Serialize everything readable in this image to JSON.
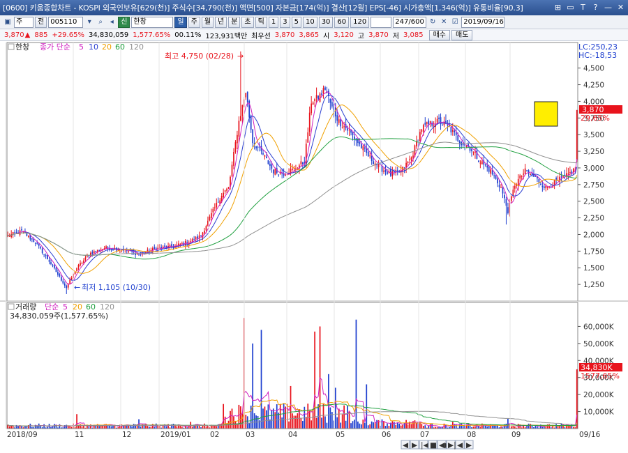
{
  "window": {
    "title": "[0600] 키움종합차트 - KOSPI 외국인보유[629(천)] 주식수[34,790(천)] 액면[500] 자본금[174(억)] 결산[12월] EPS[-46] 시가총액[1,346(억)] 유통비율[90.3]",
    "window_buttons": [
      "⊞",
      "▭",
      "T",
      "?",
      "—",
      "✕"
    ]
  },
  "toolbar": {
    "market": "주",
    "market_btn": "전",
    "code": "005110",
    "stock_badge": "신",
    "stock_name": "한창",
    "period_buttons": [
      "일",
      "주",
      "월",
      "년",
      "분",
      "초",
      "틱"
    ],
    "period_selected": "일",
    "minute_buttons": [
      "1",
      "3",
      "5",
      "10",
      "30",
      "60",
      "120"
    ],
    "count": "247",
    "count_total": "/600",
    "date": "2019/09/16"
  },
  "quote": {
    "price": "3,870",
    "change": "885",
    "change_pct": "+29.65%",
    "volume": "34,830,059",
    "volume_pct": "1,577.65%",
    "turnover": "00.11%",
    "amount": "123,931백만",
    "priority_label": "최우선",
    "bid1": "3,870",
    "bid2": "3,865",
    "open_label": "시",
    "open": "3,120",
    "high_label": "고",
    "high": "3,870",
    "low_label": "저",
    "low": "3,085",
    "buy_label": "매수",
    "sell_label": "매도"
  },
  "price_pane": {
    "title": "한창",
    "legend_label": "종가 단순",
    "ma": [
      {
        "period": "5",
        "color": "#d020c0"
      },
      {
        "period": "10",
        "color": "#2a3ed0"
      },
      {
        "period": "20",
        "color": "#f0a000"
      },
      {
        "period": "60",
        "color": "#20a040"
      },
      {
        "period": "120",
        "color": "#909090"
      }
    ],
    "lc": "LC:250,23",
    "hc": "HC:-18,53",
    "current_price_tag": "3,870",
    "current_pct_tag": "29,65%",
    "high_note": "최고 4,750 (02/28)",
    "low_note": "최저 1,105 (10/30)"
  },
  "volume_pane": {
    "title": "거래량",
    "legend_label": "단순",
    "ma": [
      {
        "period": "5",
        "color": "#d020c0"
      },
      {
        "period": "20",
        "color": "#f0a000"
      },
      {
        "period": "60",
        "color": "#20a040"
      },
      {
        "period": "120",
        "color": "#909090"
      }
    ],
    "current_text": "34,830,059주(1,577.65%)",
    "current_tag": "34,830K",
    "current_pct_tag": "1577,65%"
  },
  "date_axis": {
    "labels": [
      "2018/09",
      "11",
      "12",
      "2019/01",
      "02",
      "03",
      "04",
      "05",
      "06",
      "07",
      "08",
      "09"
    ],
    "right_label": "09/16"
  },
  "nav_buttons": [
    "◀",
    "▶",
    "|◀",
    "■",
    "◀▶",
    "▶|",
    "◀",
    "▶"
  ],
  "colors": {
    "up": "#e8131c",
    "down": "#1e3fcf",
    "tag_bg": "#e8131c",
    "marker": "#ffee00"
  },
  "chart_data": {
    "type": "candlestick",
    "price_axis": {
      "ylim": [
        1000,
        4800
      ],
      "ticks": [
        "4,500",
        "4,250",
        "4,000",
        "3,750",
        "3,500",
        "3,250",
        "3,000",
        "2,750",
        "2,500",
        "2,250",
        "2,000",
        "1,750",
        "1,500",
        "1,250"
      ]
    },
    "volume_axis": {
      "ylim": [
        0,
        70000
      ],
      "ticks": [
        "60,000K",
        "50,000K",
        "40,000K",
        "30,000K",
        "20,000K",
        "10,000K"
      ]
    },
    "close_anchors": [
      [
        0,
        1980
      ],
      [
        8,
        2050
      ],
      [
        16,
        1880
      ],
      [
        24,
        1600
      ],
      [
        34,
        1200
      ],
      [
        40,
        1500
      ],
      [
        48,
        1720
      ],
      [
        56,
        1800
      ],
      [
        66,
        1780
      ],
      [
        76,
        1700
      ],
      [
        86,
        1790
      ],
      [
        96,
        1820
      ],
      [
        106,
        1900
      ],
      [
        112,
        1980
      ],
      [
        118,
        2300
      ],
      [
        124,
        2600
      ],
      [
        128,
        2700
      ],
      [
        134,
        3700
      ],
      [
        138,
        4150
      ],
      [
        142,
        3400
      ],
      [
        148,
        3200
      ],
      [
        154,
        2950
      ],
      [
        160,
        2920
      ],
      [
        166,
        2980
      ],
      [
        172,
        3100
      ],
      [
        176,
        4000
      ],
      [
        180,
        4050
      ],
      [
        184,
        4200
      ],
      [
        188,
        3900
      ],
      [
        192,
        3700
      ],
      [
        198,
        3550
      ],
      [
        204,
        3350
      ],
      [
        210,
        3150
      ],
      [
        216,
        3000
      ],
      [
        222,
        2900
      ],
      [
        228,
        2950
      ],
      [
        234,
        3150
      ],
      [
        240,
        3600
      ],
      [
        244,
        3650
      ],
      [
        250,
        3700
      ],
      [
        256,
        3600
      ],
      [
        262,
        3400
      ],
      [
        268,
        3300
      ],
      [
        274,
        3100
      ],
      [
        280,
        2950
      ],
      [
        286,
        2700
      ],
      [
        290,
        2350
      ],
      [
        294,
        2750
      ],
      [
        300,
        2950
      ],
      [
        306,
        2850
      ],
      [
        312,
        2700
      ],
      [
        318,
        2800
      ],
      [
        324,
        2880
      ],
      [
        329,
        2985
      ],
      [
        330,
        3870
      ]
    ]
  }
}
